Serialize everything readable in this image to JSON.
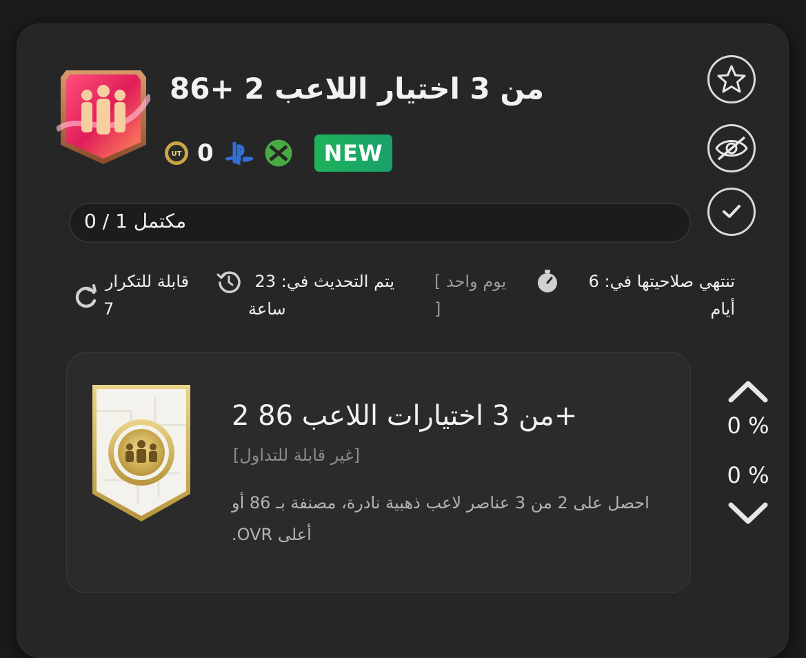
{
  "objective": {
    "title": "من 3 اختيار اللاعب 2 +86",
    "coins": "0",
    "new_label": "NEW",
    "progress_text": "مكتمل 1 / 0",
    "expires_label": "تنتهي صلاحيتها في: 6",
    "expires_unit": "أيام",
    "duration_open": "[ يوم واحد",
    "duration_close": "]",
    "refresh_label": "يتم التحديث في: 23",
    "refresh_unit": "ساعة",
    "repeatable_label": "قابلة للتكرار",
    "repeatable_count": "7"
  },
  "reward": {
    "title": "+من 3 اختيارات اللاعب 86 2",
    "subtitle": "[غير قابلة للتداول]",
    "description": "احصل على 2 من 3 عناصر لاعب ذهبية نادرة، مصنفة بـ 86 أو أعلى OVR."
  },
  "percentages": {
    "upper": "0 %",
    "lower": "0 %"
  },
  "icons": {
    "favorite": "star-icon",
    "hide": "eye-off-icon",
    "complete": "check-icon",
    "coin": "ut-coin-icon",
    "playstation": "playstation-icon",
    "xbox": "xbox-icon",
    "expires": "stopwatch-icon",
    "refresh": "history-icon",
    "repeat": "repeat-icon"
  },
  "colors": {
    "background": "#1b1b1b",
    "card": "#262626",
    "new_badge": "#1fb25a",
    "playstation": "#2f6fd6",
    "xbox": "#49a942",
    "gold": "#c9a646"
  }
}
